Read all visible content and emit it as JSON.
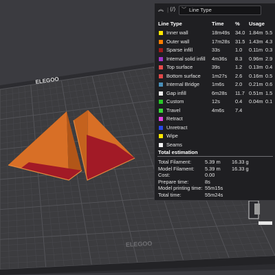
{
  "bed": {
    "logo_top": "ELEGOO",
    "logo_bottom": "ELEGOO"
  },
  "panel": {
    "collapse_icon": "chevrons-up-icon",
    "code_icon": "code-icon",
    "view_selector": {
      "icon": "chevron-down-icon",
      "value": "Line Type"
    },
    "headers": {
      "name": "Line Type",
      "time": "Time",
      "percent": "%",
      "usage": "Usage"
    },
    "line_types": [
      {
        "name": "Inner wall",
        "color": "#ffe800",
        "time": "18m49s",
        "percent": "34.0",
        "usage_m": "1.84m",
        "usage_g": "5.5"
      },
      {
        "name": "Outer wall",
        "color": "#ff7f00",
        "time": "17m28s",
        "percent": "31.5",
        "usage_m": "1.43m",
        "usage_g": "4.3"
      },
      {
        "name": "Sparse infill",
        "color": "#a01a1a",
        "time": "33s",
        "percent": "1.0",
        "usage_m": "0.11m",
        "usage_g": "0.3"
      },
      {
        "name": "Internal solid infill",
        "color": "#a035c8",
        "time": "4m36s",
        "percent": "8.3",
        "usage_m": "0.96m",
        "usage_g": "2.9"
      },
      {
        "name": "Top surface",
        "color": "#e64c4c",
        "time": "39s",
        "percent": "1.2",
        "usage_m": "0.13m",
        "usage_g": "0.4"
      },
      {
        "name": "Bottom surface",
        "color": "#e04848",
        "time": "1m27s",
        "percent": "2.6",
        "usage_m": "0.16m",
        "usage_g": "0.5"
      },
      {
        "name": "Internal Bridge",
        "color": "#4a8fb8",
        "time": "1m6s",
        "percent": "2.0",
        "usage_m": "0.21m",
        "usage_g": "0.6"
      },
      {
        "name": "Gap infill",
        "color": "#f0f0f0",
        "time": "6m28s",
        "percent": "11.7",
        "usage_m": "0.51m",
        "usage_g": "1.5"
      },
      {
        "name": "Custom",
        "color": "#28c828",
        "time": "12s",
        "percent": "0.4",
        "usage_m": "0.04m",
        "usage_g": "0.1"
      },
      {
        "name": "Travel",
        "color": "#38d838",
        "time": "4m6s",
        "percent": "7.4",
        "usage_m": "",
        "usage_g": ""
      },
      {
        "name": "Retract",
        "color": "#e040e0",
        "time": "",
        "percent": "",
        "usage_m": "",
        "usage_g": ""
      },
      {
        "name": "Unretract",
        "color": "#2848e8",
        "time": "",
        "percent": "",
        "usage_m": "",
        "usage_g": ""
      },
      {
        "name": "Wipe",
        "color": "#ffe800",
        "time": "",
        "percent": "",
        "usage_m": "",
        "usage_g": ""
      },
      {
        "name": "Seams",
        "color": "#f4f4f4",
        "time": "",
        "percent": "",
        "usage_m": "",
        "usage_g": ""
      }
    ],
    "estimation": {
      "title": "Total estimation",
      "rows": [
        {
          "label": "Total Filament:",
          "value": "5.39 m",
          "extra": "16.33 g"
        },
        {
          "label": "Model Filament:",
          "value": "5.39 m",
          "extra": "16.33 g"
        },
        {
          "label": "Cost:",
          "value": "0.00",
          "extra": ""
        },
        {
          "label": "Prepare time:",
          "value": "8s",
          "extra": ""
        },
        {
          "label": "Model printing time:",
          "value": "55m15s",
          "extra": ""
        },
        {
          "label": "Total time:",
          "value": "55m24s",
          "extra": ""
        }
      ]
    }
  }
}
